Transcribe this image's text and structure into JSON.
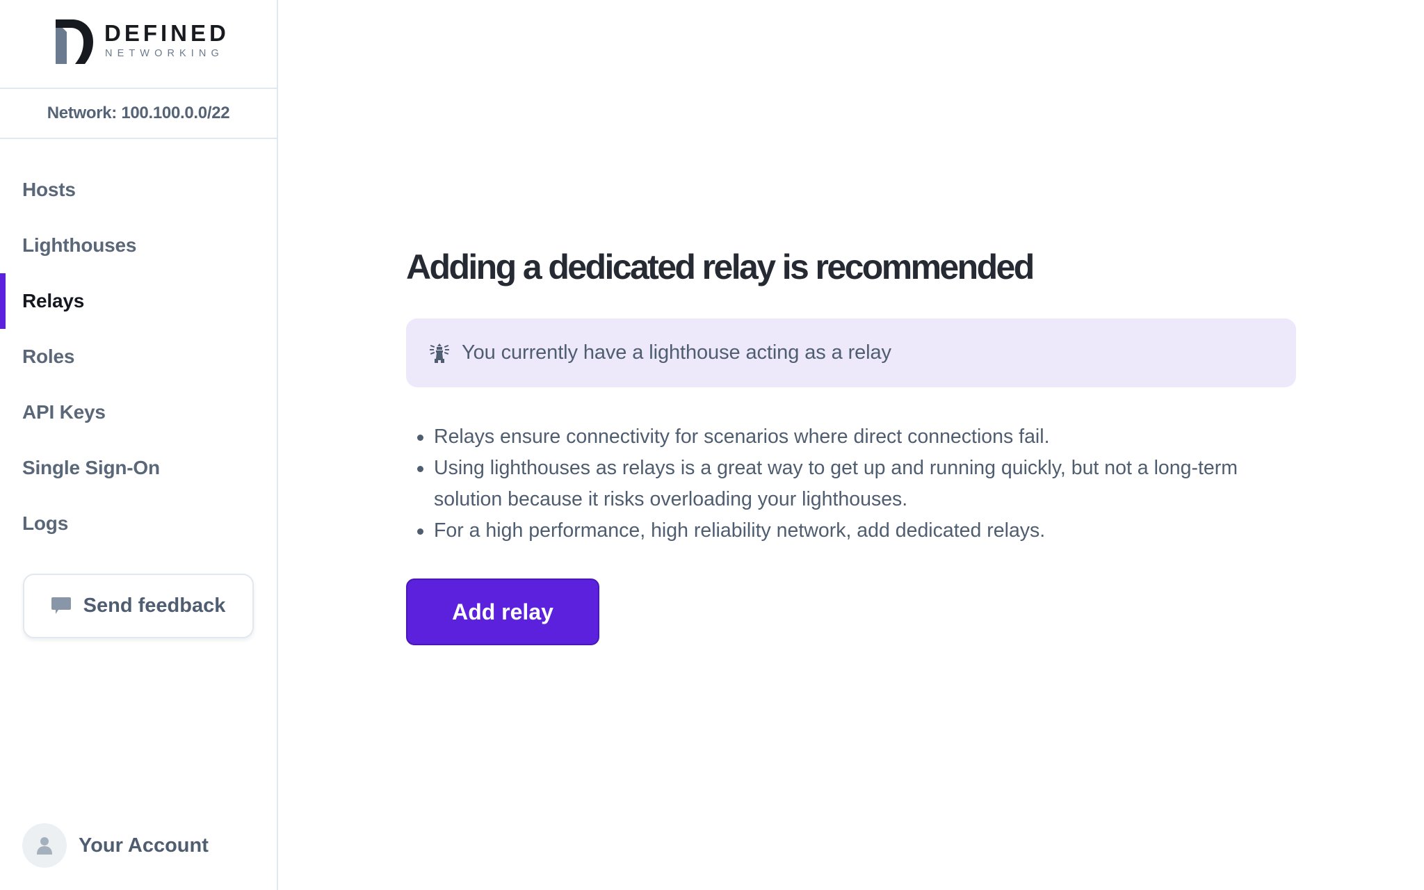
{
  "brand": {
    "name_line1": "DEFINED",
    "name_line2": "NETWORKING",
    "logo_icon": "defined-networking-logo-icon"
  },
  "sidebar": {
    "network_label": "Network: 100.100.0.0/22",
    "items": [
      {
        "label": "Hosts",
        "active": false
      },
      {
        "label": "Lighthouses",
        "active": false
      },
      {
        "label": "Relays",
        "active": true
      },
      {
        "label": "Roles",
        "active": false
      },
      {
        "label": "API Keys",
        "active": false
      },
      {
        "label": "Single Sign-On",
        "active": false
      },
      {
        "label": "Logs",
        "active": false
      }
    ],
    "feedback": {
      "label": "Send feedback",
      "icon": "chat-bubble-icon"
    },
    "account": {
      "label": "Your Account",
      "icon": "user-icon"
    }
  },
  "main": {
    "title": "Adding a dedicated relay is recommended",
    "callout": {
      "icon": "lighthouse-icon",
      "text": "You currently have a lighthouse acting as a relay"
    },
    "bullets": [
      "Relays ensure connectivity for scenarios where direct connections fail.",
      "Using lighthouses as relays is a great way to get up and running quickly, but not a long-term solution because it risks overloading your lighthouses.",
      "For a high performance, high reliability network, add dedicated relays."
    ],
    "add_button_label": "Add relay"
  },
  "colors": {
    "accent": "#5b21dd",
    "callout_bg": "#ede9fb",
    "text_muted": "#4f5d70",
    "text_dark": "#262a33",
    "border": "#e2e8f0"
  }
}
